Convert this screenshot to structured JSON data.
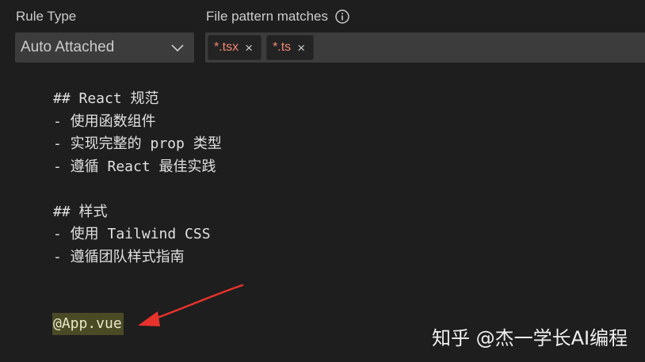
{
  "header": {
    "rule_type_label": "Rule Type",
    "file_pattern_label": "File pattern matches"
  },
  "rule_type_select": {
    "value": "Auto Attached"
  },
  "file_patterns": [
    {
      "text": "*.tsx",
      "close": "×"
    },
    {
      "text": "*.ts",
      "close": "×"
    }
  ],
  "editor": {
    "lines": [
      "## React 规范",
      "- 使用函数组件",
      "- 实现完整的 prop 类型",
      "- 遵循 React 最佳实践",
      "",
      "## 样式",
      "- 使用 Tailwind CSS",
      "- 遵循团队样式指南"
    ],
    "mention": "@App.vue"
  },
  "watermark": "知乎 @杰一学长AI编程",
  "colors": {
    "background": "#1e1e1e",
    "input_background": "#3c3c3c",
    "tag_text": "#f48771",
    "mention_highlight": "#4a4a25",
    "annotation_arrow": "#e8322c"
  },
  "icons": {
    "info": "info-icon",
    "dropdown": "chevron-down-icon",
    "annotation": "red-arrow"
  }
}
